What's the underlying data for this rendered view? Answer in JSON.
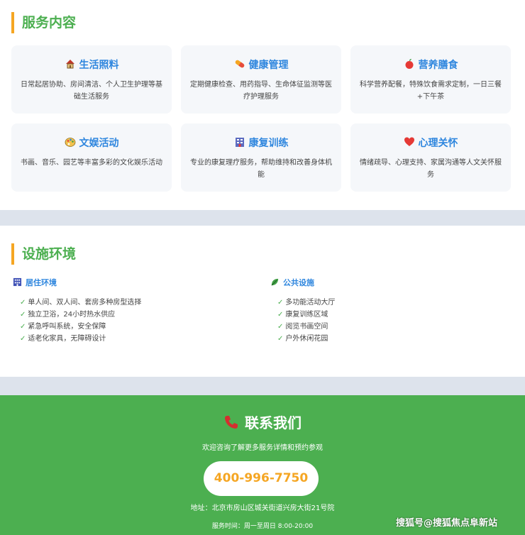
{
  "services": {
    "title": "服务内容",
    "cards": [
      {
        "icon": "house-icon",
        "title": "生活照料",
        "desc": "日常起居协助、房间清洁、个人卫生护理等基础生活服务"
      },
      {
        "icon": "pill-icon",
        "title": "健康管理",
        "desc": "定期健康检查、用药指导、生命体征监测等医疗护理服务"
      },
      {
        "icon": "apple-icon",
        "title": "营养膳食",
        "desc": "科学营养配餐，特殊饮食需求定制，一日三餐+下午茶"
      },
      {
        "icon": "palette-icon",
        "title": "文娱活动",
        "desc": "书画、音乐、园艺等丰富多彩的文化娱乐活动"
      },
      {
        "icon": "hospital-icon",
        "title": "康复训练",
        "desc": "专业的康复理疗服务，帮助维持和改善身体机能"
      },
      {
        "icon": "heart-icon",
        "title": "心理关怀",
        "desc": "情绪疏导、心理支持、家属沟通等人文关怀服务"
      }
    ]
  },
  "facilities": {
    "title": "设施环境",
    "columns": [
      {
        "icon": "building-icon",
        "title": "居住环境",
        "items": [
          "单人间、双人间、套房多种房型选择",
          "独立卫浴，24小时热水供应",
          "紧急呼叫系统，安全保障",
          "适老化家具，无障碍设计"
        ]
      },
      {
        "icon": "leaf-icon",
        "title": "公共设施",
        "items": [
          "多功能活动大厅",
          "康复训练区域",
          "阅览书画空间",
          "户外休闲花园"
        ]
      }
    ]
  },
  "contact": {
    "title": "联系我们",
    "subtitle": "欢迎咨询了解更多服务详情和预约参观",
    "phone": "400-996-7750",
    "address": "地址：北京市房山区城关街道兴房大街21号院",
    "hours": "服务时间：周一至周日 8:00-20:00"
  },
  "watermark": "搜狐号@搜狐焦点阜新站",
  "check_mark": "✓",
  "colors": {
    "accent_green": "#4caf50",
    "title_blue": "#2e86de",
    "accent_orange": "#f5a623",
    "card_bg": "#f5f7fa"
  }
}
